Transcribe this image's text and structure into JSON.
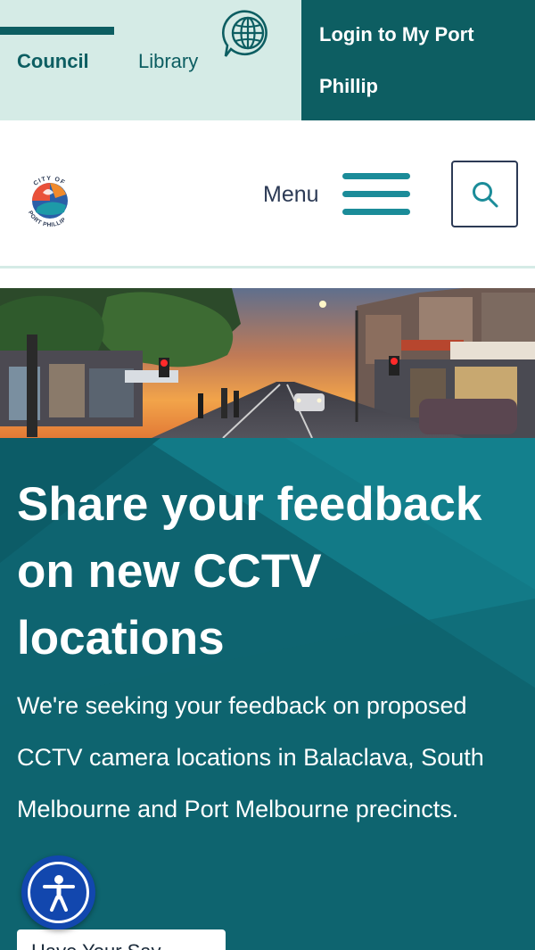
{
  "topbar": {
    "tabs": [
      {
        "label": "Council",
        "active": true
      },
      {
        "label": "Library",
        "active": false
      }
    ],
    "language_icon": "globe-chat-icon",
    "login_label": "Login to My Port Phillip"
  },
  "header": {
    "logo_text_top": "CITY OF",
    "logo_text_bottom": "PORT PHILLIP",
    "menu_label": "Menu",
    "menu_icon": "hamburger-icon",
    "search_icon": "search-icon"
  },
  "hero": {
    "image_icon": "street-photo"
  },
  "feature": {
    "title": "Share your feedback on new CCTV locations",
    "description": "We're seeking your feedback on proposed CCTV camera locations in Balaclava, South Melbourne and Port Melbourne precincts.",
    "cta_label": "Have Your Say →"
  },
  "accessibility": {
    "icon": "accessibility-person-icon"
  },
  "colors": {
    "brand_dark_teal": "#0d5e62",
    "light_mint": "#d5ebe6",
    "accent_teal": "#1b8c99",
    "feature_teal": "#106a75",
    "navy_text": "#2c3a55",
    "a11y_blue": "#1247ae"
  }
}
